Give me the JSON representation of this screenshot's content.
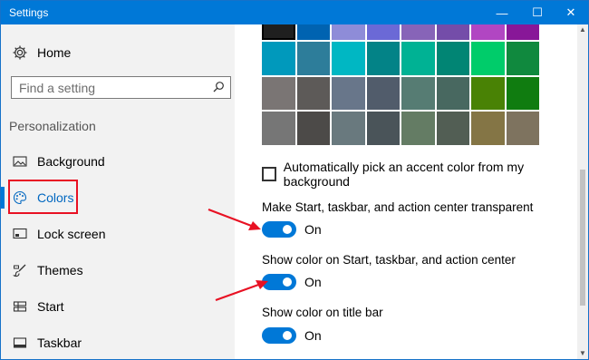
{
  "window": {
    "title": "Settings",
    "minimize": "—",
    "maximize": "☐",
    "close": "✕"
  },
  "sidebar": {
    "home_label": "Home",
    "search_placeholder": "Find a setting",
    "section_title": "Personalization",
    "items": [
      {
        "label": "Background",
        "icon": "image-icon",
        "active": false
      },
      {
        "label": "Colors",
        "icon": "palette-icon",
        "active": true
      },
      {
        "label": "Lock screen",
        "icon": "lock-screen-icon",
        "active": false
      },
      {
        "label": "Themes",
        "icon": "brush-icon",
        "active": false
      },
      {
        "label": "Start",
        "icon": "start-icon",
        "active": false
      },
      {
        "label": "Taskbar",
        "icon": "taskbar-icon",
        "active": false
      }
    ]
  },
  "swatches": {
    "rows": [
      [
        "#1f1f1f",
        "#0063b1",
        "#8e8cd8",
        "#6b69d6",
        "#8764b8",
        "#744da9",
        "#b146c2",
        "#881798"
      ],
      [
        "#0099bc",
        "#2d7d9a",
        "#00b7c3",
        "#038387",
        "#00b294",
        "#018574",
        "#00cc6a",
        "#10893e"
      ],
      [
        "#7a7574",
        "#5d5a58",
        "#68768a",
        "#515c6b",
        "#567c73",
        "#486860",
        "#498205",
        "#107c10"
      ],
      [
        "#767676",
        "#4c4a48",
        "#69797e",
        "#4a5459",
        "#647c64",
        "#525e54",
        "#847545",
        "#7e735f"
      ]
    ],
    "selected": [
      0,
      0
    ]
  },
  "settings": {
    "auto_accent_label": "Automatically pick an accent color from my background",
    "transparent_label": "Make Start, taskbar, and action center transparent",
    "transparent_state": "On",
    "show_color_start_label": "Show color on Start, taskbar, and action center",
    "show_color_start_state": "On",
    "show_color_title_label": "Show color on title bar",
    "show_color_title_state": "On"
  },
  "colors": {
    "accent": "#0078d7",
    "annotation": "#e81123"
  }
}
